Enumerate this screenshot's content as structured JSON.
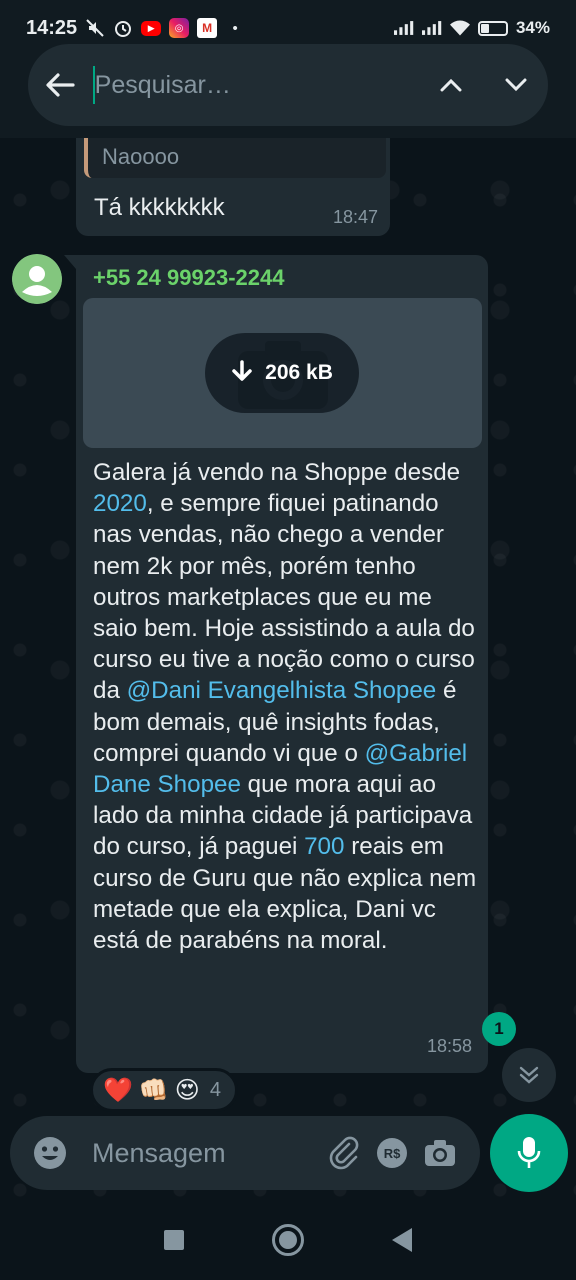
{
  "status_bar": {
    "time": "14:25",
    "battery_text": "34%",
    "battery_level": 0.34,
    "icons": [
      "mute-icon",
      "alarm-icon",
      "youtube-icon",
      "instagram-icon",
      "gmail-icon",
      "dot-icon",
      "signal-icon",
      "signal-icon",
      "wifi-icon",
      "battery-icon"
    ]
  },
  "search": {
    "placeholder": "Pesquisar…"
  },
  "previous_message": {
    "quoted_text": "Naoooo",
    "text": "Tá kkkkkkkk",
    "time": "18:47"
  },
  "main_message": {
    "sender": "+55 24 99923-2244",
    "media_size": "206 kB",
    "body": [
      {
        "t": "Galera já vendo na Shoppe desde "
      },
      {
        "t": "2020",
        "link": true
      },
      {
        "t": ", e sempre fiquei patinando nas vendas, não chego a vender nem 2k por mês, porém tenho outros marketplaces que eu me saio bem. Hoje assistindo a aula do curso eu tive a noção como o curso da "
      },
      {
        "t": "@Dani Evangelhista Shopee",
        "link": true
      },
      {
        "t": " é bom demais, quê insights fodas, comprei quando vi que o "
      },
      {
        "t": "@Gabriel Dane Shopee",
        "link": true
      },
      {
        "t": " que mora aqui ao lado da minha cidade já participava do curso, já paguei "
      },
      {
        "t": "700",
        "link": true
      },
      {
        "t": " reais em curso de Guru que não explica nem metade que ela explica, Dani vc está de parabéns na moral."
      }
    ],
    "time": "18:58",
    "reactions": [
      "❤️",
      "👊🏻",
      "😍"
    ],
    "reaction_count": "4"
  },
  "unread_count": "1",
  "composer": {
    "placeholder": "Mensagem",
    "rs_label": "R$"
  },
  "colors": {
    "accent": "#00a884",
    "link": "#53bdeb",
    "sender": "#6bd26a",
    "bubble": "#202c33",
    "background": "#0b141a"
  }
}
